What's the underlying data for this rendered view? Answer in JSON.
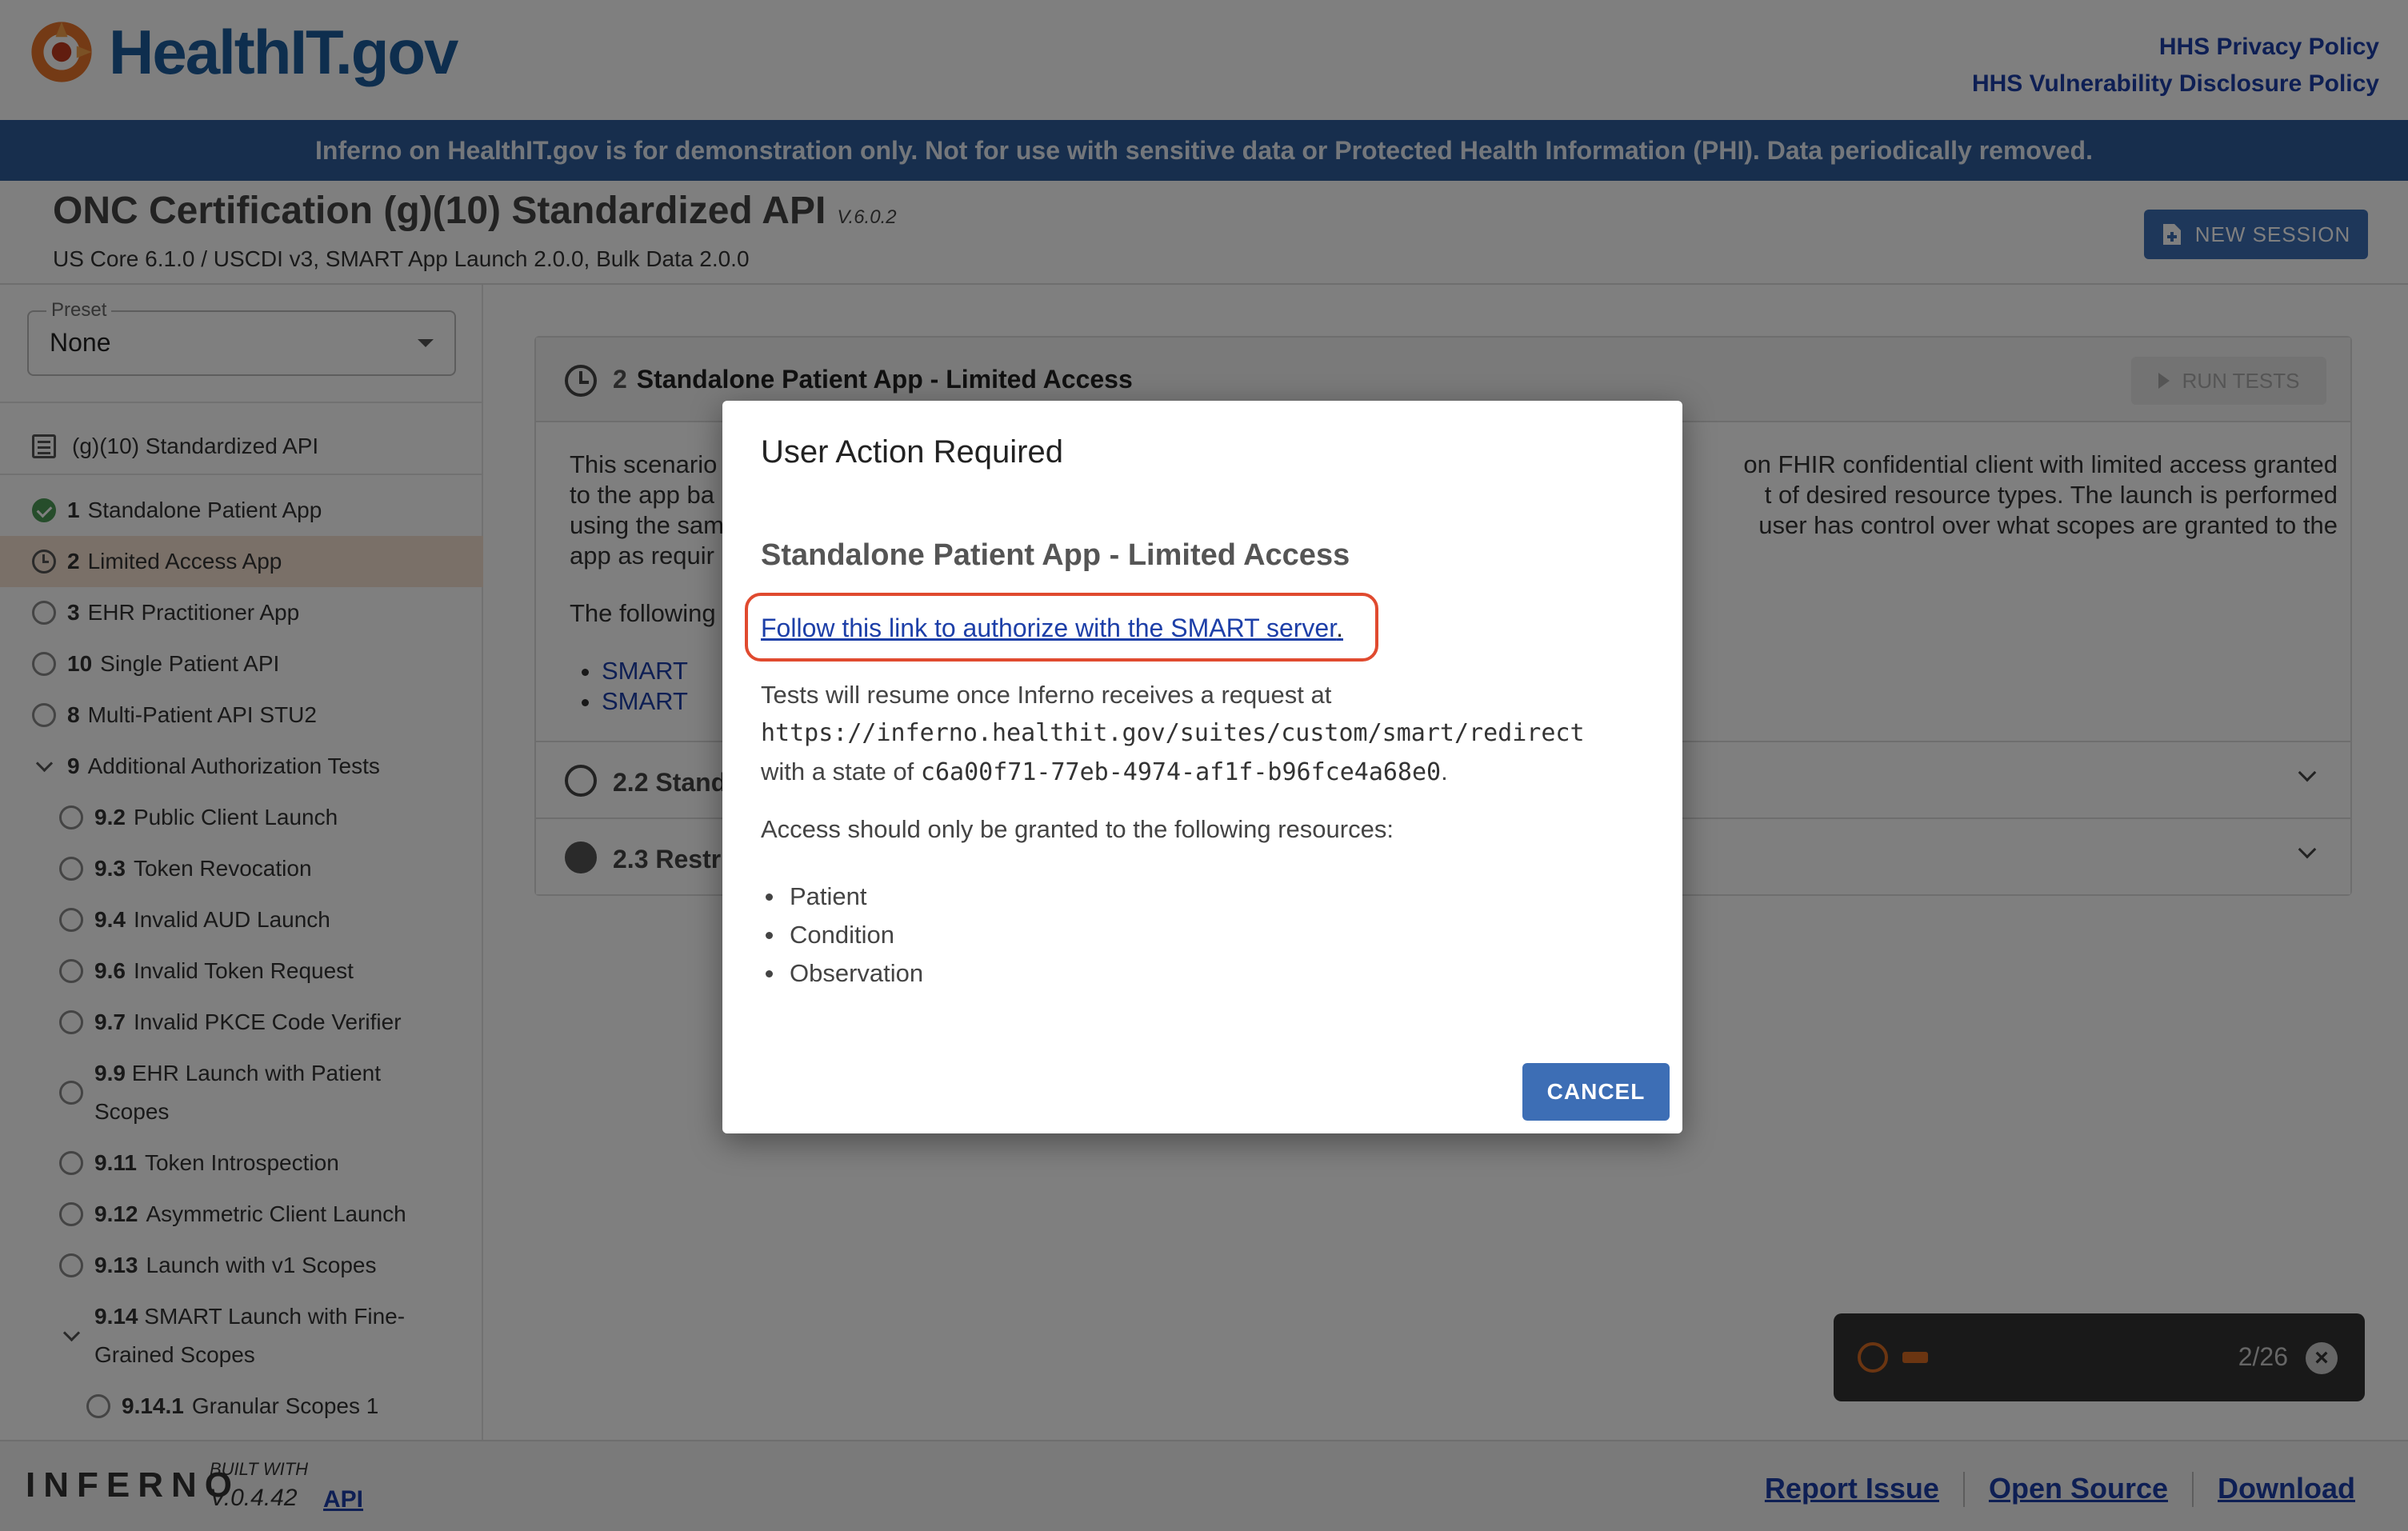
{
  "header": {
    "logo_text": "HealthIT.gov",
    "privacy_link": "HHS Privacy Policy",
    "vulnerability_link": "HHS Vulnerability Disclosure Policy"
  },
  "banner": {
    "text": "Inferno on HealthIT.gov is for demonstration only. Not for use with sensitive data or Protected Health Information (PHI). Data periodically removed."
  },
  "suite": {
    "title": "ONC Certification (g)(10) Standardized API",
    "version": "V.6.0.2",
    "subtitle": "US Core 6.1.0 / USCDI v3, SMART App Launch 2.0.0, Bulk Data 2.0.0",
    "new_session_label": "NEW SESSION"
  },
  "sidebar": {
    "preset_label": "Preset",
    "preset_value": "None",
    "suite_link": "(g)(10) Standardized API",
    "items": [
      {
        "num": "1",
        "label": "Standalone Patient App",
        "status": "pass"
      },
      {
        "num": "2",
        "label": "Limited Access App",
        "status": "running"
      },
      {
        "num": "3",
        "label": "EHR Practitioner App",
        "status": "pending"
      },
      {
        "num": "10",
        "label": "Single Patient API",
        "status": "pending"
      },
      {
        "num": "8",
        "label": "Multi-Patient API STU2",
        "status": "pending"
      },
      {
        "num": "9",
        "label": "Additional Authorization Tests",
        "status": "expanded"
      },
      {
        "num": "9.2",
        "label": "Public Client Launch",
        "status": "pending"
      },
      {
        "num": "9.3",
        "label": "Token Revocation",
        "status": "pending"
      },
      {
        "num": "9.4",
        "label": "Invalid AUD Launch",
        "status": "pending"
      },
      {
        "num": "9.6",
        "label": "Invalid Token Request",
        "status": "pending"
      },
      {
        "num": "9.7",
        "label": "Invalid PKCE Code Verifier",
        "status": "pending"
      },
      {
        "num": "9.9",
        "label": "EHR Launch with Patient",
        "label2": "Scopes",
        "status": "pending"
      },
      {
        "num": "9.11",
        "label": "Token Introspection",
        "status": "pending"
      },
      {
        "num": "9.12",
        "label": "Asymmetric Client Launch",
        "status": "pending"
      },
      {
        "num": "9.13",
        "label": "Launch with v1 Scopes",
        "status": "pending"
      },
      {
        "num": "9.14",
        "label": "SMART Launch with Fine-",
        "label2": "Grained Scopes",
        "status": "expanded"
      },
      {
        "num": "9.14.1",
        "label": "Granular Scopes 1",
        "status": "pending"
      }
    ]
  },
  "main": {
    "group_num": "2",
    "group_title": "Standalone Patient App - Limited Access",
    "run_tests_label": "RUN TESTS",
    "desc_line1_left": "This scenario",
    "desc_line1_right": "on FHIR confidential client with limited access granted",
    "desc_line2_left": "to the app ba",
    "desc_line2_right": "t of desired resource types. The launch is performed",
    "desc_line3_left": "using the sam",
    "desc_line3_right": "user has control over what scopes are granted to the",
    "desc_line4_left": "app as requir",
    "following_text": "The following",
    "link1": "SMART",
    "link2": "SMART",
    "sub1_num": "2.2",
    "sub1_title": "Stand",
    "sub2_num": "2.3",
    "sub2_title": "Restri"
  },
  "modal": {
    "title": "User Action Required",
    "subtitle": "Standalone Patient App - Limited Access",
    "auth_link": "Follow this link to authorize with the SMART server",
    "auth_period": ".",
    "resume_text": "Tests will resume once Inferno receives a request at",
    "redirect_url": "https://inferno.healthit.gov/suites/custom/smart/redirect",
    "state_prefix": "with a state of",
    "state_value": "c6a00f71-77eb-4974-af1f-b96fce4a68e0",
    "state_suffix": ".",
    "access_text": "Access should only be granted to the following resources:",
    "resources": [
      "Patient",
      "Condition",
      "Observation"
    ],
    "cancel_label": "CANCEL"
  },
  "toast": {
    "count": "2/26"
  },
  "footer": {
    "logo_text": "INFERNO",
    "built_with": "BUILT WITH",
    "version": "V.0.4.42",
    "api_link": "API",
    "links": [
      "Report Issue",
      "Open Source",
      "Download"
    ]
  },
  "colors": {
    "banner": "#2f5d9a",
    "primary_button": "#3d6eb5",
    "active_row": "#f4e0d0",
    "highlight_border": "#e04a2f",
    "pass": "#4c9a57"
  }
}
